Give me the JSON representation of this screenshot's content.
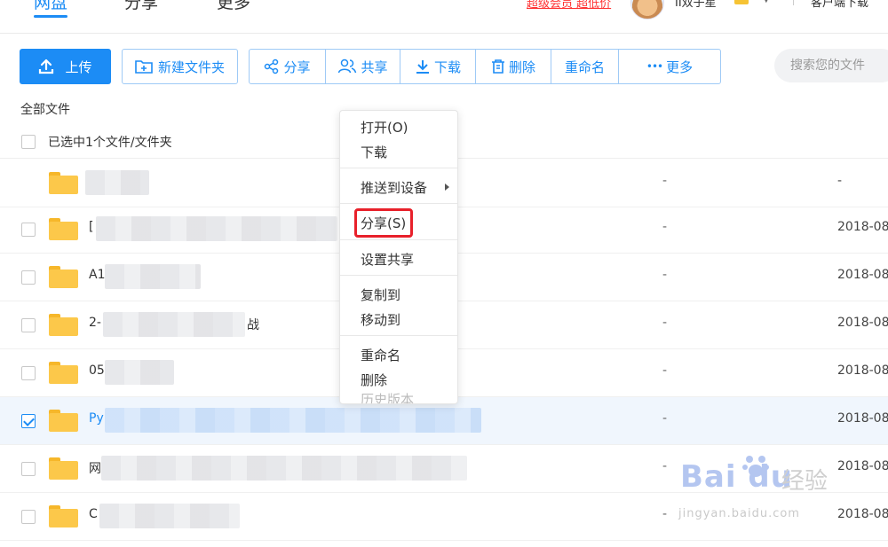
{
  "nav": {
    "tabs": [
      "网盘",
      "分享",
      "更多"
    ]
  },
  "header": {
    "vip_link": "超级会员 超低价",
    "username": "II双子星",
    "client_download": "客户端下载"
  },
  "toolbar": {
    "upload": "上传",
    "new_folder": "新建文件夹",
    "share": "分享",
    "co_share": "共享",
    "download": "下载",
    "delete": "删除",
    "rename": "重命名",
    "more": "更多",
    "more_dots": "•••"
  },
  "search": {
    "placeholder": "搜索您的文件"
  },
  "breadcrumb": "全部文件",
  "selection": {
    "text": "已选中1个文件/文件夹"
  },
  "rows": [
    {
      "name": "",
      "size": "-",
      "date": "-",
      "checked": false
    },
    {
      "name": "[",
      "size": "-",
      "date": "2018-08-",
      "checked": false
    },
    {
      "name": "A1",
      "size": "-",
      "date": "2018-08-",
      "checked": false
    },
    {
      "name": "2-",
      "suffix": "战",
      "size": "-",
      "date": "2018-08-",
      "checked": false
    },
    {
      "name": "05",
      "size": "-",
      "date": "2018-08-",
      "checked": false
    },
    {
      "name": "Py",
      "size": "-",
      "date": "2018-08-",
      "checked": true
    },
    {
      "name": "网",
      "size": "-",
      "date": "2018-08-",
      "checked": false
    },
    {
      "name": "C",
      "size": "-",
      "date": "2018-08-",
      "checked": false
    }
  ],
  "context_menu": {
    "open": "打开(O)",
    "download": "下载",
    "push_to_device": "推送到设备",
    "share": "分享(S)",
    "set_share": "设置共享",
    "copy_to": "复制到",
    "move_to": "移动到",
    "rename": "重命名",
    "delete": "删除",
    "history": "历史版本"
  },
  "watermark": {
    "logo": "Bai du",
    "cn": "经验",
    "url": "jingyan.baidu.com"
  },
  "colors": {
    "accent": "#1c8cf5",
    "highlight": "#e8202a",
    "folder": "#fcc84a"
  }
}
